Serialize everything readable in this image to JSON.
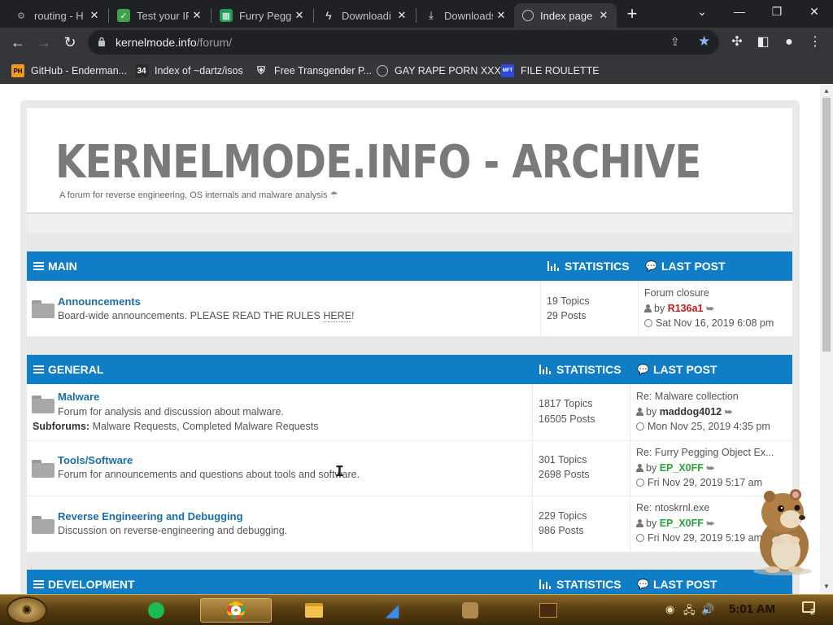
{
  "browser": {
    "tabs": [
      {
        "label": "routing - H",
        "icon": "gear-icon"
      },
      {
        "label": "Test your IP",
        "icon": "checkmark-icon"
      },
      {
        "label": "Furry Pegg",
        "icon": "spreadsheet-icon"
      },
      {
        "label": "Downloadi",
        "icon": "lightning-icon"
      },
      {
        "label": "Downloads",
        "icon": "download-icon"
      },
      {
        "label": "Index page",
        "icon": "globe-icon",
        "active": true
      }
    ],
    "url_host": "kernelmode.info",
    "url_path": "/forum/",
    "bookmarks": [
      {
        "label": "GitHub - Enderman...",
        "icon": "PH"
      },
      {
        "label": "Index of ~dartz/isos",
        "icon": "34"
      },
      {
        "label": "Free Transgender P...",
        "icon": "crest-icon"
      },
      {
        "label": "GAY RAPE PORN XXX",
        "icon": "globe-icon"
      },
      {
        "label": "FILE ROULETTE",
        "icon": "MFT"
      }
    ]
  },
  "site": {
    "title": "KERNELMODE.INFO - ARCHIVE",
    "description": "A forum for reverse engineering, OS internals and malware analysis"
  },
  "categories": [
    {
      "name": "MAIN",
      "statistics_label": "STATISTICS",
      "last_post_label": "LAST POST",
      "forums": [
        {
          "name": "Announcements",
          "description_prefix": "Board-wide announcements. PLEASE READ THE RULES ",
          "description_link": "HERE",
          "description_suffix": "!",
          "topics": "19 Topics",
          "posts": "29 Posts",
          "last_title": "Forum closure",
          "last_by": "by",
          "last_user": "R136a1",
          "last_date": "Sat Nov 16, 2019 6:08 pm"
        }
      ]
    },
    {
      "name": "GENERAL",
      "statistics_label": "STATISTICS",
      "last_post_label": "LAST POST",
      "forums": [
        {
          "name": "Malware",
          "description": "Forum for analysis and discussion about malware.",
          "subforums_label": "Subforums:",
          "subforums": "Malware Requests, Completed Malware Requests",
          "topics": "1817 Topics",
          "posts": "16505 Posts",
          "last_title": "Re: Malware collection",
          "last_by": "by",
          "last_user": "maddog4012",
          "last_date": "Mon Nov 25, 2019 4:35 pm"
        },
        {
          "name": "Tools/Software",
          "description": "Forum for announcements and questions about tools and software.",
          "topics": "301 Topics",
          "posts": "2698 Posts",
          "last_title": "Re: Furry Pegging Object Ex...",
          "last_by": "by",
          "last_user": "EP_X0FF",
          "last_date": "Fri Nov 29, 2019 5:17 am"
        },
        {
          "name": "Reverse Engineering and Debugging",
          "description": "Discussion on reverse-engineering and debugging.",
          "topics": "229 Topics",
          "posts": "986 Posts",
          "last_title": "Re: ntoskrnl.exe",
          "last_by": "by",
          "last_user": "EP_X0FF",
          "last_date": "Fri Nov 29, 2019 5:19 am"
        }
      ]
    },
    {
      "name": "DEVELOPMENT",
      "statistics_label": "STATISTICS",
      "last_post_label": "LAST POST",
      "forums": []
    }
  ],
  "taskbar": {
    "clock": "5:01 AM",
    "notification_count": "2"
  },
  "colors": {
    "category_header": "#0f7ec6",
    "forum_link": "#1b6ea8",
    "user_red": "#c9191f",
    "user_green": "#2aa63b"
  }
}
